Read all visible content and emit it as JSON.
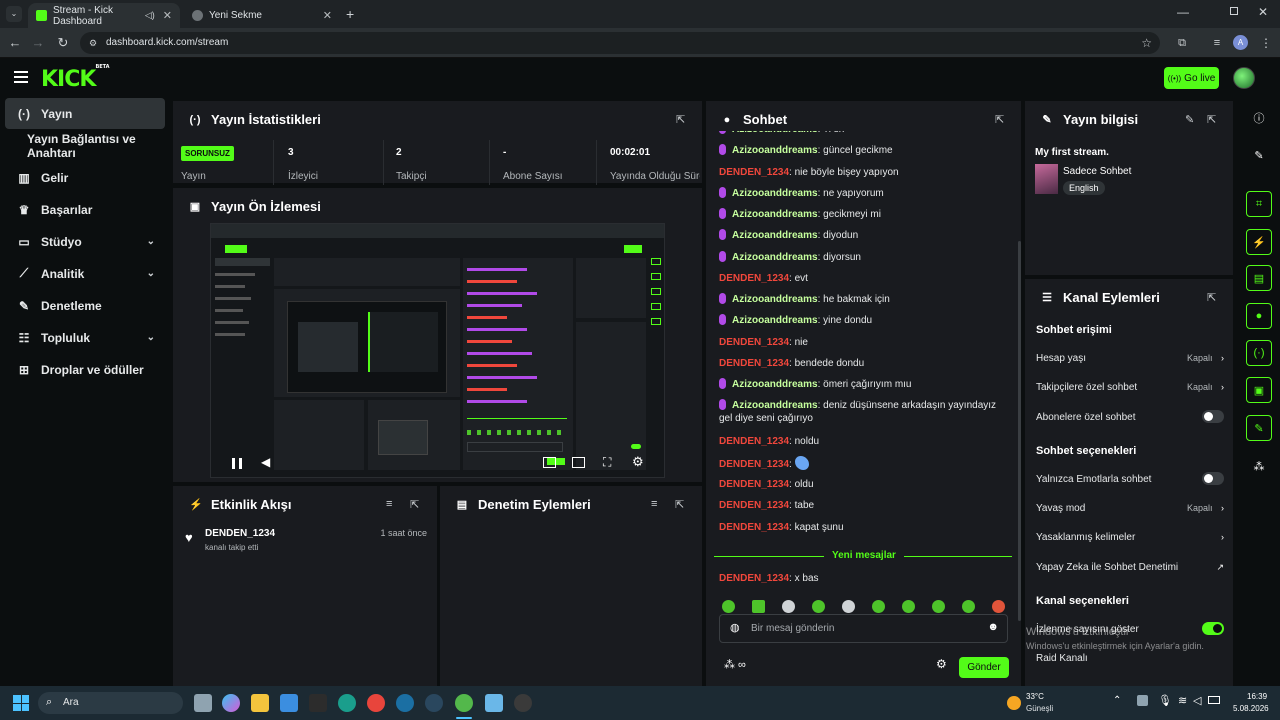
{
  "browser": {
    "tabs": [
      {
        "title": "Stream - Kick Dashboard"
      },
      {
        "title": "Yeni Sekme"
      }
    ],
    "url": "dashboard.kick.com/stream",
    "profile_initial": "A"
  },
  "header": {
    "logo": "KICK",
    "logo_sup": "BETA",
    "go_live_label": "Go live"
  },
  "sidebar": {
    "items": [
      {
        "label": "Yayın",
        "icon": "signal-icon",
        "active": true
      },
      {
        "label": "Yayın Bağlantısı ve Anahtarı",
        "icon": "",
        "active": false
      },
      {
        "label": "Gelir",
        "icon": "chart-icon",
        "active": false
      },
      {
        "label": "Başarılar",
        "icon": "trophy-icon",
        "active": false
      },
      {
        "label": "Stüdyo",
        "icon": "studio-icon",
        "active": false,
        "expandable": true
      },
      {
        "label": "Analitik",
        "icon": "analytics-icon",
        "active": false,
        "expandable": true
      },
      {
        "label": "Denetleme",
        "icon": "wrench-icon",
        "active": false
      },
      {
        "label": "Topluluk",
        "icon": "community-icon",
        "active": false,
        "expandable": true
      },
      {
        "label": "Droplar ve ödüller",
        "icon": "drops-icon",
        "active": false
      }
    ]
  },
  "stats": {
    "title": "Yayın İstatistikleri",
    "status_badge": "SORUNSUZ",
    "items": [
      {
        "value": "",
        "label": "Yayın"
      },
      {
        "value": "3",
        "label": "İzleyici"
      },
      {
        "value": "2",
        "label": "Takipçi"
      },
      {
        "value": "-",
        "label": "Abone Sayısı"
      },
      {
        "value": "00:02:01",
        "label": "Yayında Olduğu Süre"
      }
    ]
  },
  "preview": {
    "title": "Yayın Ön İzlemesi"
  },
  "activity": {
    "title": "Etkinlik Akışı",
    "items": [
      {
        "user": "DENDEN_1234",
        "action": "kanalı takip etti",
        "time": "1 saat önce"
      }
    ]
  },
  "moderation": {
    "title": "Denetim Eylemleri"
  },
  "chat": {
    "title": "Sohbet",
    "messages": [
      {
        "user": "Azizooanddreams",
        "text": "Ti sn",
        "badge": true
      },
      {
        "user": "Azizooanddreams",
        "text": "güncel gecikme",
        "badge": true
      },
      {
        "user": "DENDEN_1234",
        "text": "nie böyle bişey yapıyon",
        "badge": false
      },
      {
        "user": "Azizooanddreams",
        "text": "ne yapıyorum",
        "badge": true
      },
      {
        "user": "Azizooanddreams",
        "text": "gecikmeyi mi",
        "badge": true
      },
      {
        "user": "Azizooanddreams",
        "text": "diyodun",
        "badge": true
      },
      {
        "user": "Azizooanddreams",
        "text": "diyorsun",
        "badge": true
      },
      {
        "user": "DENDEN_1234",
        "text": "evt",
        "badge": false
      },
      {
        "user": "Azizooanddreams",
        "text": "he bakmak için",
        "badge": true
      },
      {
        "user": "Azizooanddreams",
        "text": "yine dondu",
        "badge": true
      },
      {
        "user": "DENDEN_1234",
        "text": "nie",
        "badge": false
      },
      {
        "user": "DENDEN_1234",
        "text": "bendede dondu",
        "badge": false
      },
      {
        "user": "Azizooanddreams",
        "text": "ömeri çağırıyım mıu",
        "badge": true
      },
      {
        "user": "Azizooanddreams",
        "text": "deniz düşünsene arkadaşın yayındayız gel diye seni çağırıyo",
        "badge": true
      },
      {
        "user": "DENDEN_1234",
        "text": "noldu",
        "badge": false
      },
      {
        "user": "DENDEN_1234",
        "text": "",
        "badge": false,
        "emote": true
      },
      {
        "user": "DENDEN_1234",
        "text": "oldu",
        "badge": false
      },
      {
        "user": "DENDEN_1234",
        "text": "tabe",
        "badge": false
      },
      {
        "user": "DENDEN_1234",
        "text": "kapat şunu",
        "badge": false
      },
      {
        "user": "DENDEN_1234",
        "text": "x bas",
        "badge": false
      }
    ],
    "new_messages_label": "Yeni mesajlar",
    "input_placeholder": "Bir mesaj gönderin",
    "send_label": "Gönder"
  },
  "stream_info": {
    "title": "Yayın bilgisi",
    "stream_title": "My first stream.",
    "category": "Sadece Sohbet",
    "language": "English"
  },
  "channel_actions": {
    "title": "Kanal Eylemleri",
    "chat_access_heading": "Sohbet erişimi",
    "chat_access": [
      {
        "label": "Hesap yaşı",
        "value": "Kapalı",
        "type": "link"
      },
      {
        "label": "Takipçilere özel sohbet",
        "value": "Kapalı",
        "type": "link"
      },
      {
        "label": "Abonelere özel sohbet",
        "value": "",
        "type": "toggle",
        "on": false
      }
    ],
    "chat_options_heading": "Sohbet seçenekleri",
    "chat_options": [
      {
        "label": "Yalnızca Emotlarla sohbet",
        "value": "",
        "type": "toggle",
        "on": false
      },
      {
        "label": "Yavaş mod",
        "value": "Kapalı",
        "type": "link"
      },
      {
        "label": "Yasaklanmış kelimeler",
        "value": "",
        "type": "link"
      },
      {
        "label": "Yapay Zeka ile Sohbet Denetimi",
        "value": "",
        "type": "external"
      }
    ],
    "channel_options_heading": "Kanal seçenekleri",
    "channel_options": [
      {
        "label": "İzlenme sayısını göster",
        "value": "",
        "type": "toggle",
        "on": true
      },
      {
        "label": "Raid Kanalı",
        "value": "",
        "type": "link"
      }
    ]
  },
  "watermark": {
    "line1": "Windows'u Etkinleştir",
    "line2": "Windows'u etkinleştirmek için Ayarlar'a gidin."
  },
  "taskbar": {
    "search_label": "Ara",
    "weather_temp": "33°C",
    "weather_desc": "Güneşli",
    "time": "16:39",
    "date": "5.08.2026"
  },
  "colors": {
    "brand": "#53fc18",
    "username_red": "#f0473c",
    "panel_bg": "#191b1f",
    "app_bg": "#0b0e0f"
  }
}
